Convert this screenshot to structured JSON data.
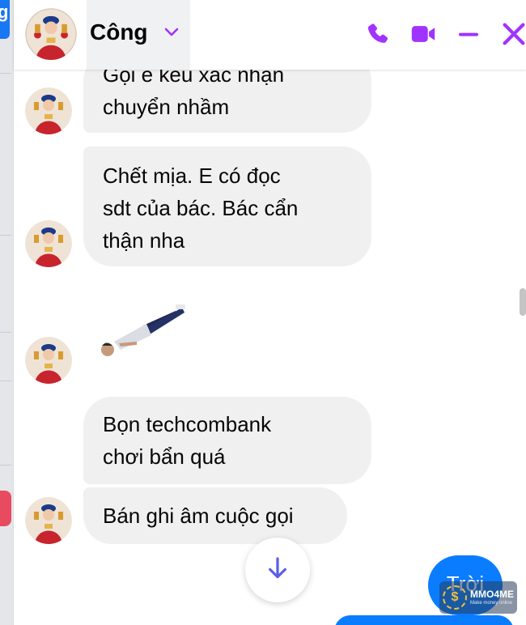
{
  "background": {
    "tab_letter": "g"
  },
  "chat": {
    "contact_name": "Công",
    "accent_color": "#a033ff",
    "icons": {
      "dropdown": "chevron-down-icon",
      "call": "phone-icon",
      "video": "video-camera-icon",
      "minimize": "minimize-icon",
      "close": "close-icon",
      "scroll_down": "arrow-down-icon"
    },
    "messages": [
      {
        "lines": [
          "Gọi e kêu xác nhận",
          "chuyển nhầm"
        ]
      },
      {
        "lines": [
          "Chết mịa. E có đọc",
          "sdt của bác. Bác cẩn",
          "thận nha"
        ]
      },
      {
        "sticker": "person-lying-sticker"
      },
      {
        "lines": [
          "Bọn techcombank",
          "chơi bẩn quá"
        ]
      },
      {
        "lines": [
          "Bán ghi âm cuộc gọi"
        ]
      }
    ],
    "outgoing": {
      "text": "Trời",
      "color": "#0a7cff"
    }
  },
  "watermark": {
    "title": "MMO4ME",
    "subtitle": "Make money online"
  }
}
